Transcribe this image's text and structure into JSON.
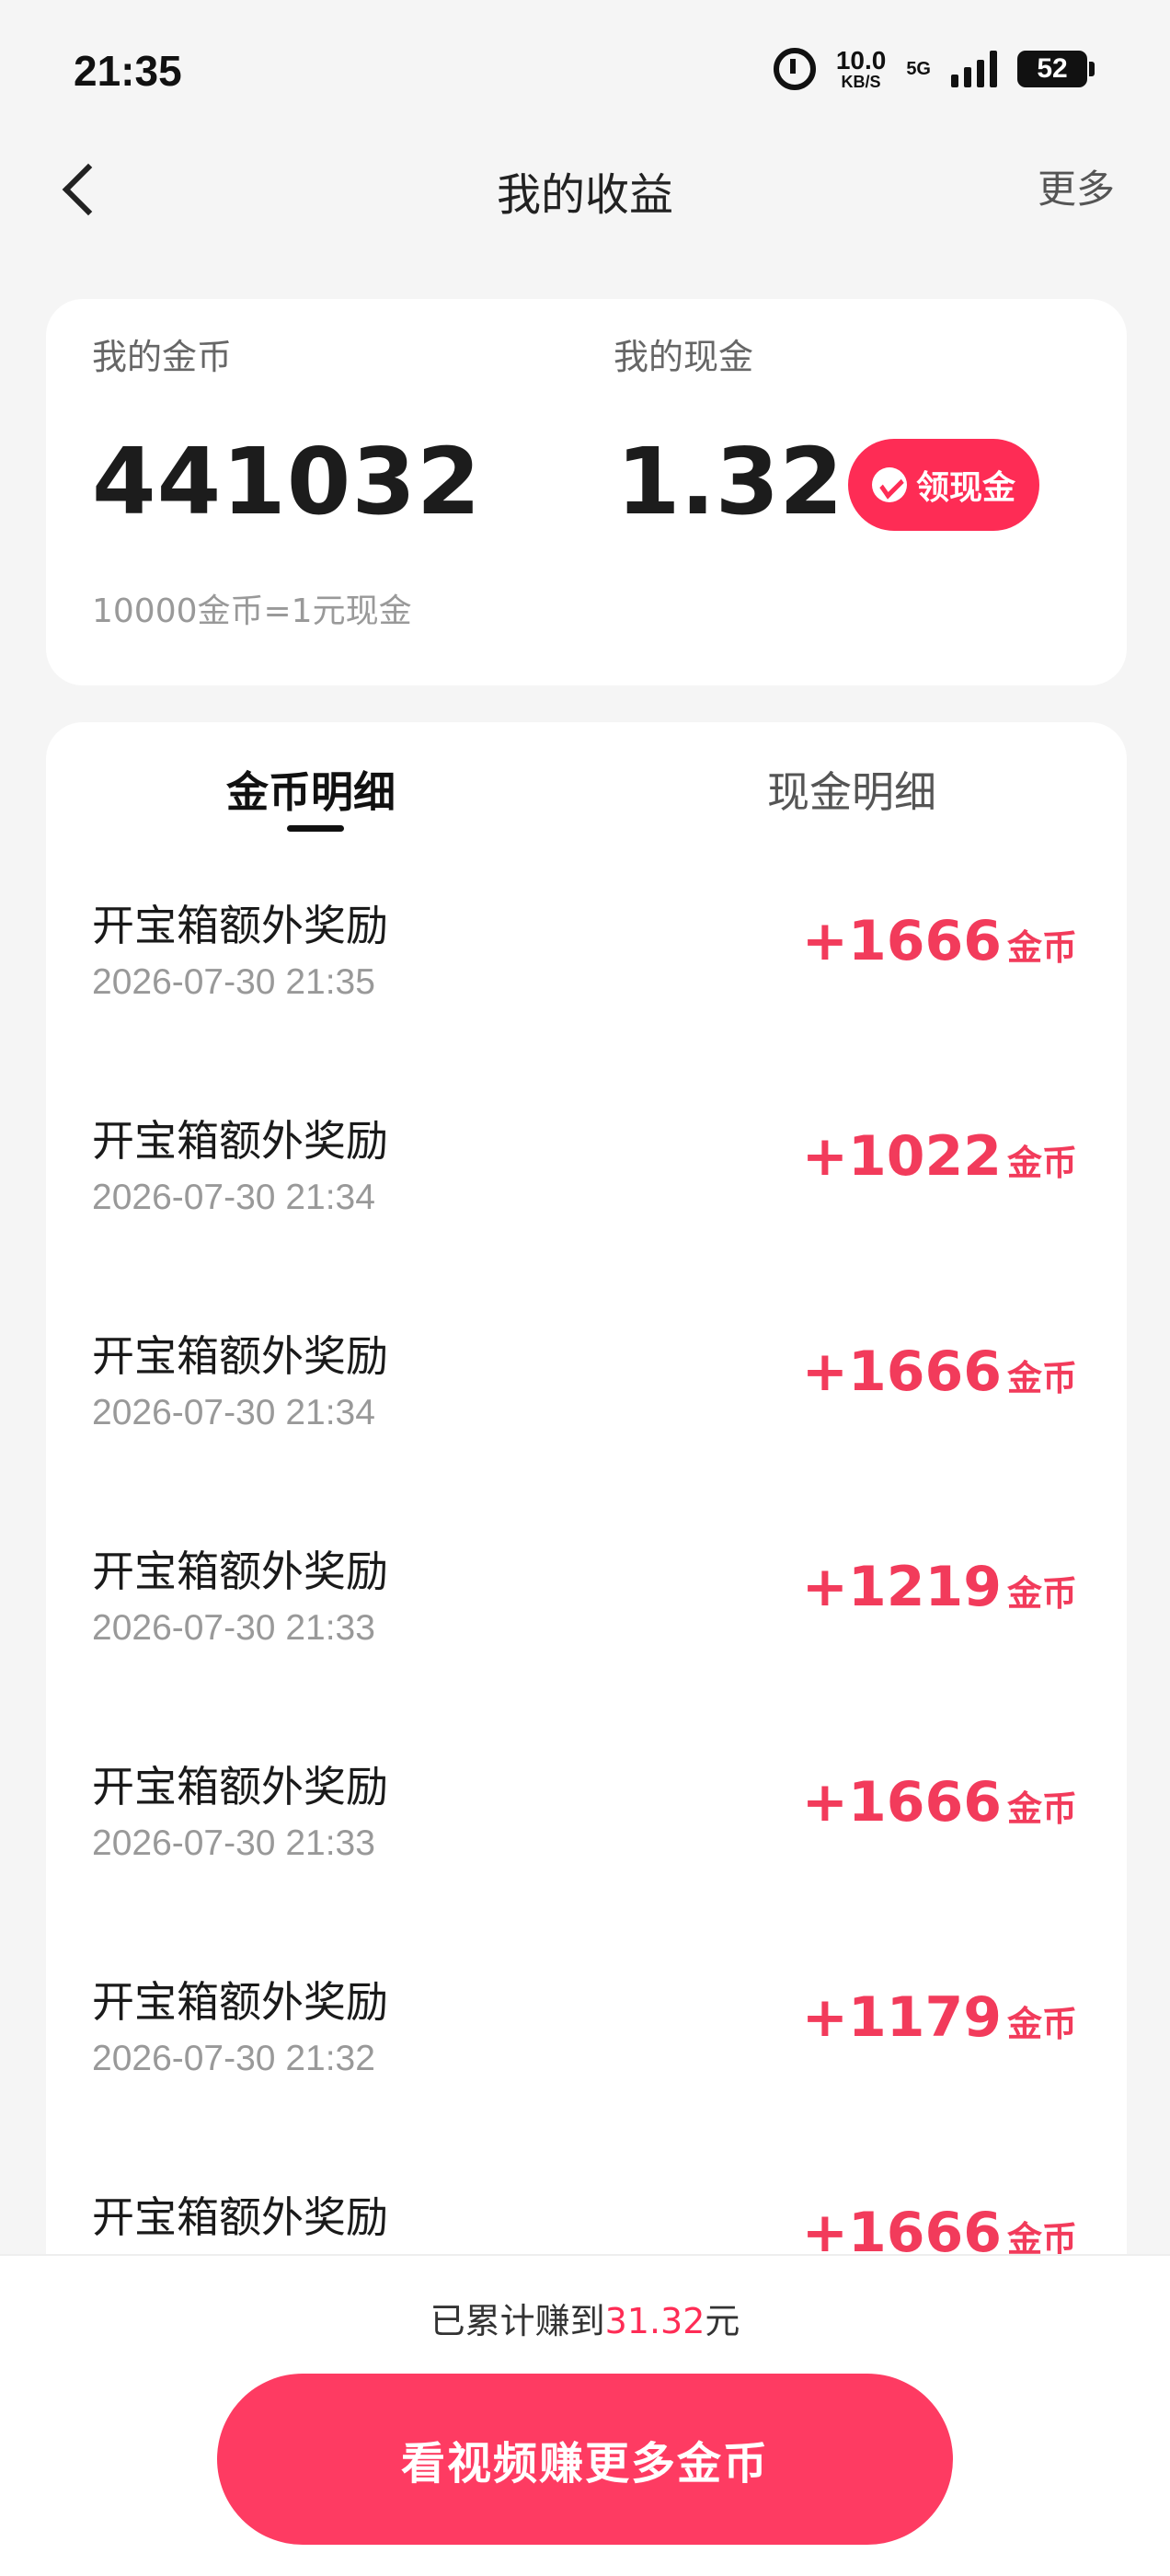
{
  "status_bar": {
    "time": "21:35",
    "net_speed_value": "10.0",
    "net_speed_unit": "KB/S",
    "network": "5G",
    "battery": "52"
  },
  "nav": {
    "title": "我的收益",
    "more": "更多"
  },
  "earnings": {
    "coin_label": "我的金币",
    "coin_value": "441032",
    "cash_label": "我的现金",
    "cash_value": "1.32",
    "withdraw_label": "领现金",
    "exchange_rate": "10000金币=1元现金"
  },
  "tabs": [
    {
      "label": "金币明细",
      "active": true
    },
    {
      "label": "现金明细",
      "active": false
    }
  ],
  "records": [
    {
      "title": "开宝箱额外奖励",
      "time": "2026-07-30 21:35",
      "amount": "+1666",
      "unit": "金币"
    },
    {
      "title": "开宝箱额外奖励",
      "time": "2026-07-30 21:34",
      "amount": "+1022",
      "unit": "金币"
    },
    {
      "title": "开宝箱额外奖励",
      "time": "2026-07-30 21:34",
      "amount": "+1666",
      "unit": "金币"
    },
    {
      "title": "开宝箱额外奖励",
      "time": "2026-07-30 21:33",
      "amount": "+1219",
      "unit": "金币"
    },
    {
      "title": "开宝箱额外奖励",
      "time": "2026-07-30 21:33",
      "amount": "+1666",
      "unit": "金币"
    },
    {
      "title": "开宝箱额外奖励",
      "time": "2026-07-30 21:32",
      "amount": "+1179",
      "unit": "金币"
    },
    {
      "title": "开宝箱额外奖励",
      "time": "",
      "amount": "+1666",
      "unit": "金币"
    }
  ],
  "footer": {
    "total_prefix": "已累计赚到",
    "total_value": "31.32",
    "total_suffix": "元",
    "cta_label": "看视频赚更多金币"
  },
  "colors": {
    "accent": "#fe2c55",
    "amount": "#f23b5b",
    "background": "#f5f5f5"
  }
}
